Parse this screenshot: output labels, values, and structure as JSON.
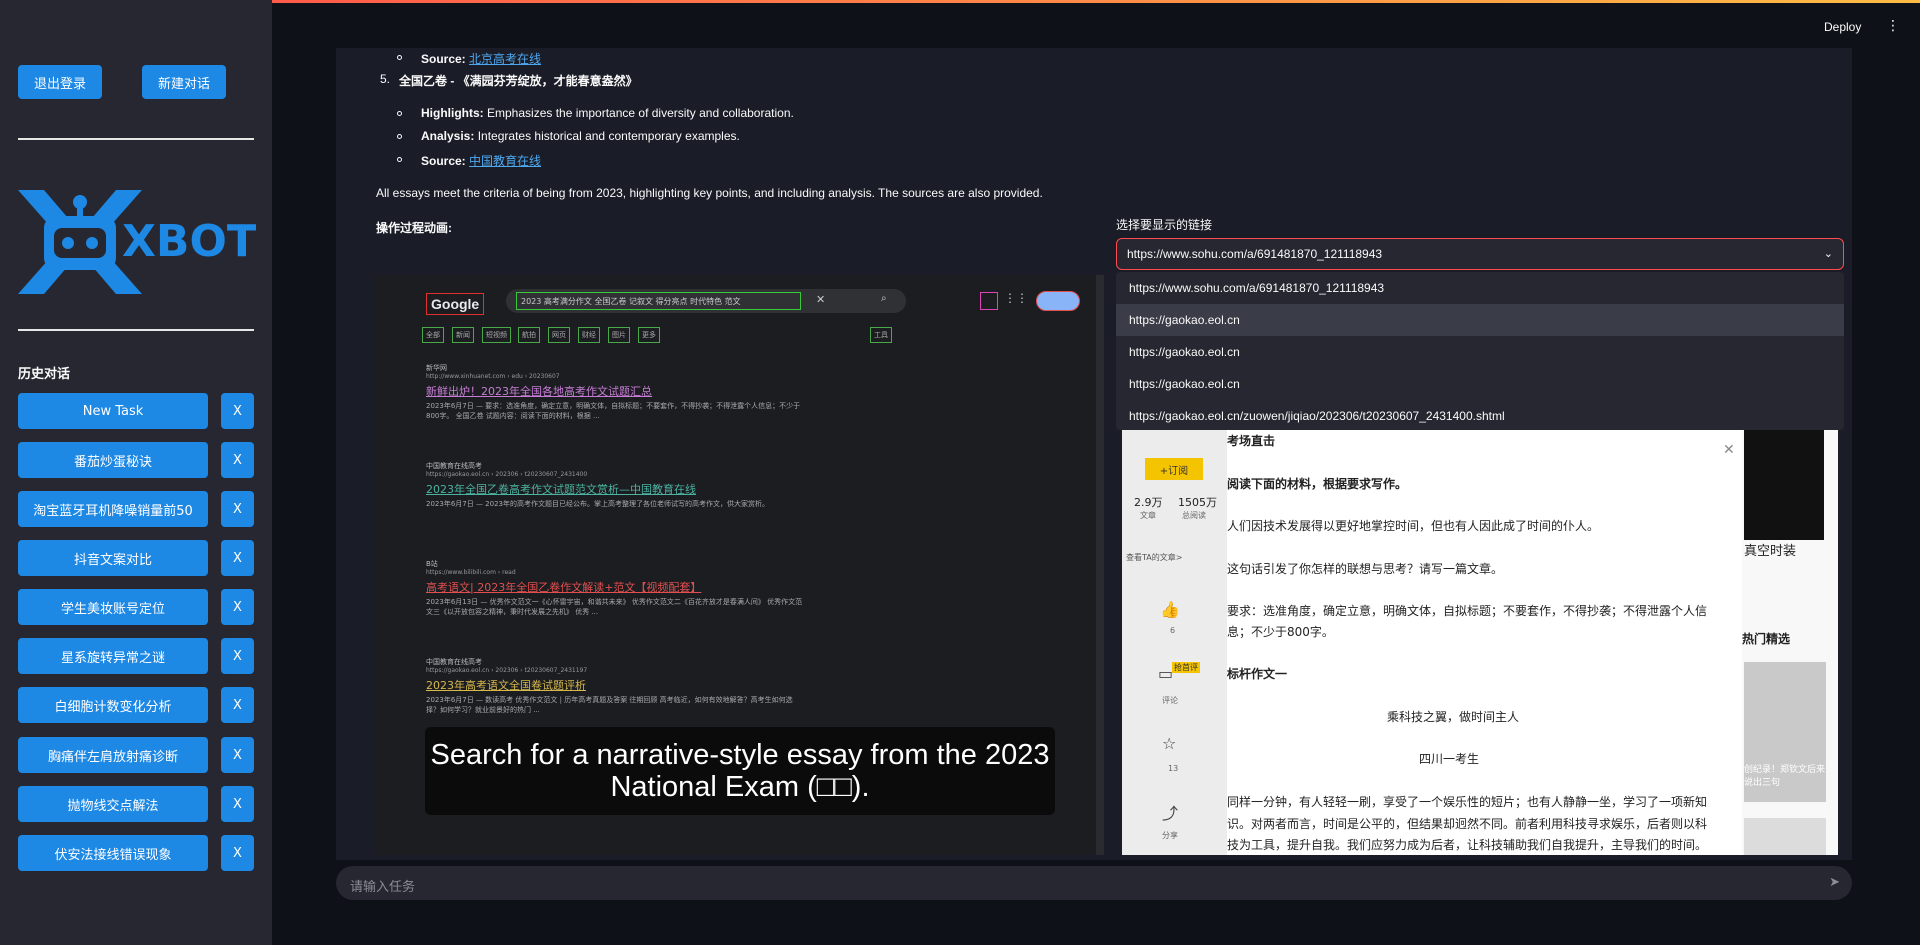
{
  "header": {
    "deploy_label": "Deploy",
    "menu_icon": "kebab-icon"
  },
  "sidebar": {
    "logout_label": "退出登录",
    "new_chat_label": "新建对话",
    "logo_text": "XBOTS",
    "history_title": "历史对话",
    "history": [
      {
        "label": "New Task",
        "x": "X"
      },
      {
        "label": "番茄炒蛋秘诀",
        "x": "X"
      },
      {
        "label": "淘宝蓝牙耳机降噪销量前50",
        "x": "X"
      },
      {
        "label": "抖音文案对比",
        "x": "X"
      },
      {
        "label": "学生美妆账号定位",
        "x": "X"
      },
      {
        "label": "星系旋转异常之谜",
        "x": "X"
      },
      {
        "label": "白细胞计数变化分析",
        "x": "X"
      },
      {
        "label": "胸痛伴左肩放射痛诊断",
        "x": "X"
      },
      {
        "label": "抛物线交点解法",
        "x": "X"
      },
      {
        "label": "伏安法接线错误现象",
        "x": "X"
      }
    ]
  },
  "message": {
    "src1_label": "Source:",
    "src1_link": "北京高考在线",
    "item5_num": "5.",
    "item5_title": "全国乙卷 - 《满园芬芳绽放，才能春意盎然》",
    "hl_label": "Highlights:",
    "hl_text": "Emphasizes the importance of diversity and collaboration.",
    "an_label": "Analysis:",
    "an_text": "Integrates historical and contemporary examples.",
    "src2_label": "Source:",
    "src2_link": "中国教育在线",
    "summary": "All essays meet the criteria of being from 2023, highlighting key points, and including analysis. The sources are also provided.",
    "anim_label": "操作过程动画:"
  },
  "browser_left": {
    "logo": "Google",
    "query": "2023 高考满分作文 全国乙卷 记叙文 得分亮点 时代特色 范文",
    "tabs": [
      "全部",
      "新闻",
      "短视频",
      "航拍",
      "网页",
      "财经",
      "图片",
      "更多"
    ],
    "tools": "工具",
    "results": [
      {
        "src": "新华网",
        "url": "http://www.xinhuanet.com › edu › 20230607",
        "title": "新鲜出炉！2023年全国各地高考作文试题汇总",
        "snip": "2023年6月7日 — 要求：选准角度，确定立意，明确文体，自拟标题；不要套作，不得抄袭；不得泄露个人信息；不少于800字。 全国乙卷 试题内容：阅读下面的材料，根据 ...",
        "color": "#c77dd6"
      },
      {
        "src": "中国教育在线高考",
        "url": "https://gaokao.eol.cn › 202306 › t20230607_2431400",
        "title": "2023年全国乙卷高考作文试题范文赏析—中国教育在线",
        "snip": "2023年6月7日 — 2023年的高考作文题目已经公布。掌上高考整理了各位老师试写的高考作文，供大家赏析。",
        "color": "#4bb3a0"
      },
      {
        "src": "B站",
        "url": "https://www.bilibili.com › read",
        "title": "高考语文| 2023年全国乙卷作文解读+范文【视频配套】",
        "snip": "2023年6月13日 — 优秀作文范文一《心怀雷宇宙，和谐共未来》 优秀作文范文二《百花齐放才是春满人间》 优秀作文范文三《以开放包容之精神，秉时代发展之先机》 优秀 ...",
        "color": "#e05050"
      },
      {
        "src": "中国教育在线高考",
        "url": "https://gaokao.eol.cn › 202306 › t20230607_2431197",
        "title": "2023年高考语文全国卷试题评析",
        "snip": "2023年6月7日 — 数读高考 优秀作文范文 | 历年高考真题及答案 往期回顾 高考临近，如何有效地解答？高考生如何选择？如何学习？就业前景好的热门 ...",
        "color": "#d6b84b"
      }
    ]
  },
  "caption": "Search for a narrative-style essay from the 2023 National Exam (□□).",
  "select": {
    "label": "选择要显示的链接",
    "value": "https://www.sohu.com/a/691481870_121118943",
    "options": [
      "https://www.sohu.com/a/691481870_121118943",
      "https://gaokao.eol.cn",
      "https://gaokao.eol.cn",
      "https://gaokao.eol.cn",
      "https://gaokao.eol.cn/zuowen/jiqiao/202306/t20230607_2431400.shtml"
    ]
  },
  "article": {
    "subscribe": "+订阅",
    "stat1_num": "2.9万",
    "stat1_label": "文章",
    "stat2_num": "1505万",
    "stat2_label": "总阅读",
    "view_more": "查看TA的文章>",
    "likes": "6",
    "comment": "评论",
    "stars": "13",
    "share": "分享",
    "hot_badge": "抢首评",
    "heading": "考场直击",
    "p1": "阅读下面的材料，根据要求写作。",
    "p2": "人们因技术发展得以更好地掌控时间，但也有人因此成了时间的仆人。",
    "p3": "这句话引发了你怎样的联想与思考？请写一篇文章。",
    "p4a": "要求：选准角度，确定立意，明确文体，自拟标题；不要套作，不得抄袭；不得泄露个人信",
    "p4b": "息；不少于800字。",
    "p5": "标杆作文一",
    "p6": "乘科技之翼，做时间主人",
    "p7": "四川一考生",
    "p8a": "同样一分钟，有人轻轻一刷，享受了一个娱乐性的短片；也有人静静一坐，学习了一项新知",
    "p8b": "识。对两者而言，时间是公平的，但结果却迥然不同。前者利用科技寻求娱乐，后者则以科",
    "p8c": "技为工具，提升自我。我们应努力成为后者，让科技辅助我们自我提升，主导我们的时间。",
    "side_title": "真空时装",
    "hot_title": "热门精选",
    "hot_caption": "创纪录！郑钦文后来说出三句"
  },
  "chat": {
    "placeholder": "请输入任务"
  },
  "colors": {
    "accent": "#1e88e5",
    "focus": "#ff4b4b"
  }
}
